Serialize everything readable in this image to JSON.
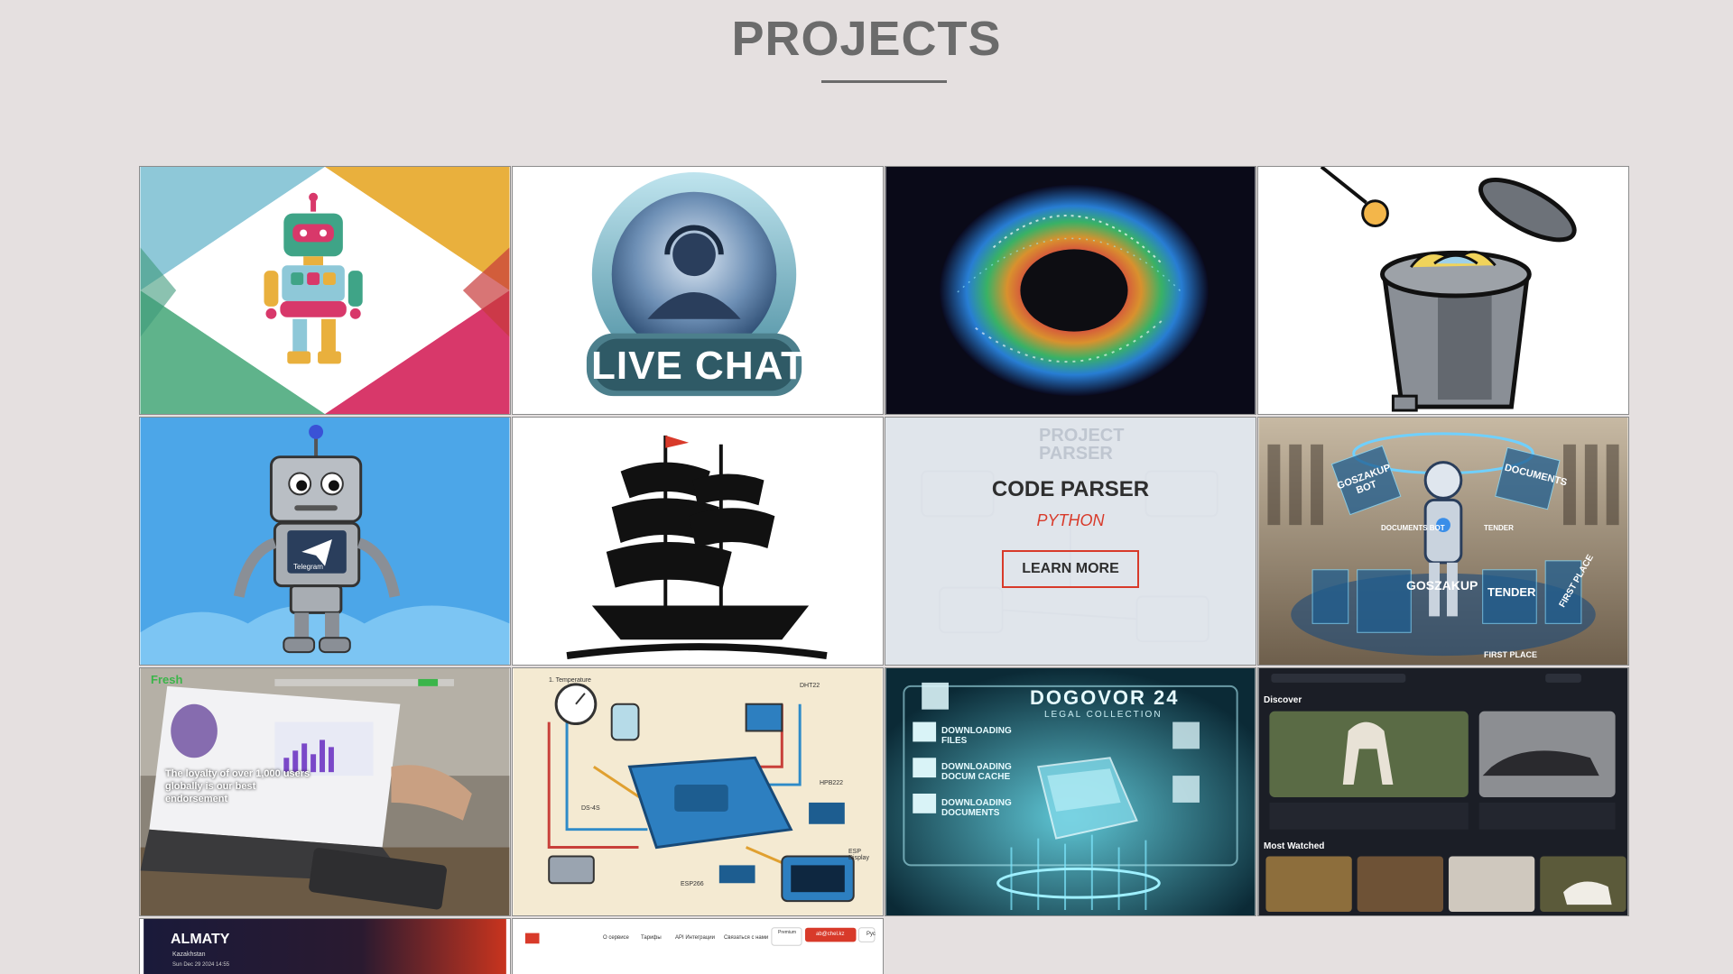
{
  "page": {
    "title": "PROJECTS"
  },
  "tiles": [
    {
      "name": "slack-robot-project",
      "icon": "robot-icon"
    },
    {
      "name": "live-chat-project",
      "icon": "headset-agent-icon",
      "text": "LIVE CHAT"
    },
    {
      "name": "color-burst-project",
      "icon": "color-swirl-icon"
    },
    {
      "name": "trash-can-project",
      "icon": "trash-can-icon"
    },
    {
      "name": "telegram-bot-project",
      "icon": "telegram-robot-icon",
      "text": "Telegram"
    },
    {
      "name": "ship-project",
      "icon": "sailing-ship-icon"
    },
    {
      "name": "code-parser-project",
      "title": "CODE PARSER",
      "subtitle": "PYTHON",
      "button": "LEARN MORE",
      "background_text": "PROJECT PARSER"
    },
    {
      "name": "goszakup-bot-project",
      "texts": [
        "GOSZAKUP BOT",
        "DOCUMENTS",
        "DOCUMENTS BOT",
        "TENDER",
        "GOSZAKUP",
        "TENDER",
        "FIRST PLACE",
        "FIRST PLACE"
      ]
    },
    {
      "name": "fresh-cash-project",
      "brand": "Fresh",
      "tagline": "The loyalty of over 1,000 users globally is our best endorsement"
    },
    {
      "name": "smart-home-project",
      "labels": [
        "1. Temperature",
        "DHT22",
        "ESP Display",
        "ESP266",
        "DS-4S",
        "HPB222"
      ]
    },
    {
      "name": "dogovor-project",
      "title": "DOGOVOR 24",
      "subtitle": "LEGAL COLLECTION",
      "items": [
        "DOWNLOADING FILES",
        "DOWNLOADING DOCUM CACHE",
        "DOWNLOADING DOCUMENTS"
      ]
    },
    {
      "name": "video-discover-project",
      "section1": "Discover",
      "section2": "Most Watched"
    },
    {
      "name": "almaty-weather-project",
      "city": "ALMATY",
      "country": "Kazakhstan",
      "date": "Sun Dec 29 2024 14:55"
    },
    {
      "name": "parser-web-project",
      "nav": [
        "О сервисе",
        "Тарифы",
        "API Интеграции",
        "Связаться с нами"
      ],
      "badge": "Premium",
      "user_button": "ab@chel.kz",
      "lang": "Рус"
    }
  ],
  "colors": {
    "title": "#6b6b6b",
    "background": "#e5e0e0",
    "accent": "#d83a2a"
  }
}
